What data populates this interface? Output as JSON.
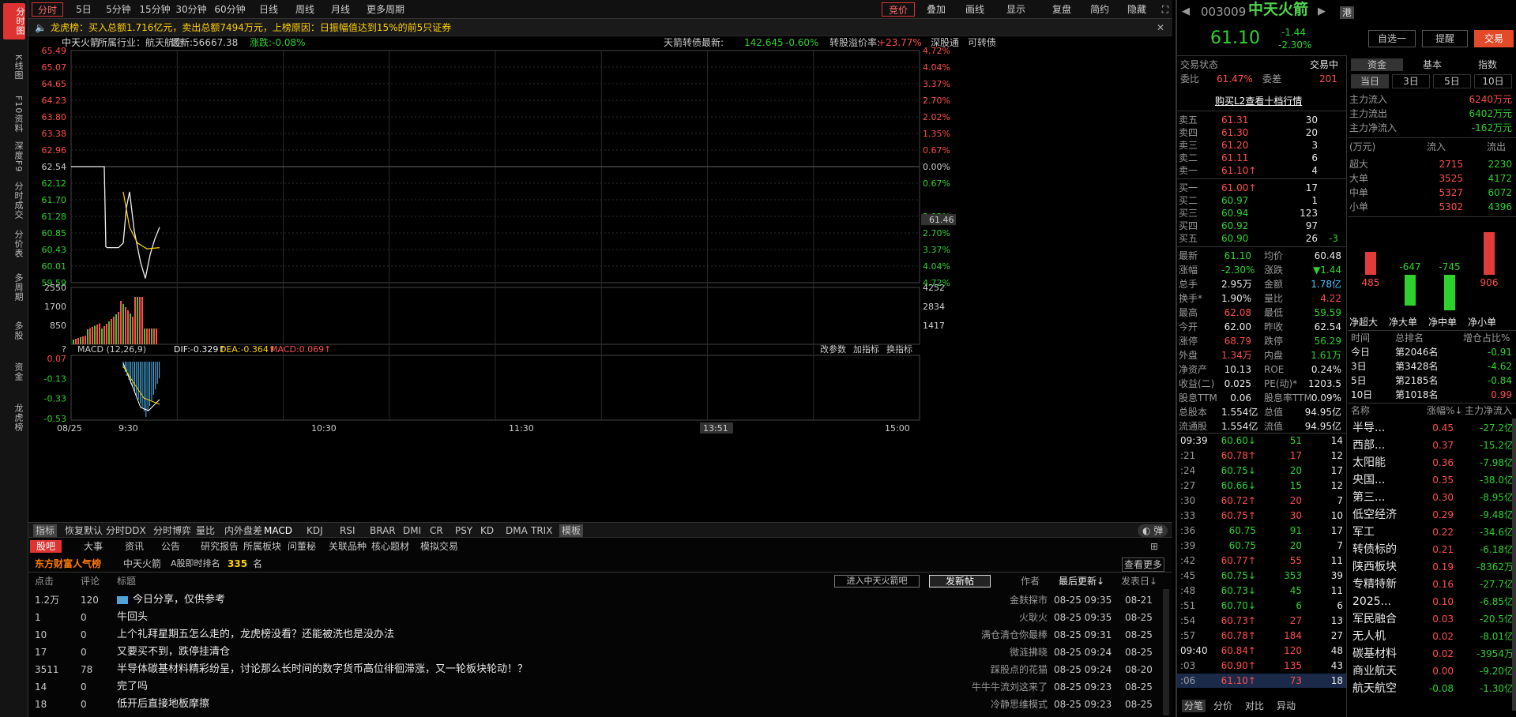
{
  "left_nav": [
    "分时图",
    "K线图",
    "F10资料",
    "深度F9",
    "分时成交",
    "分价表",
    "多周期",
    "多股",
    "资金",
    "龙虎榜"
  ],
  "toolbar": {
    "tabs": [
      "分时",
      "5日",
      "5分钟",
      "15分钟",
      "30分钟",
      "60分钟",
      "日线",
      "周线",
      "月线",
      "更多周期"
    ],
    "right": [
      "竞价",
      "叠加",
      "画线",
      "显示",
      "复盘",
      "简约",
      "隐藏"
    ]
  },
  "notice": "龙虎榜：买入总额1.716亿元，卖出总额7494万元，上榜原因：日振幅值达到15%的前5只证券",
  "chart_header": {
    "name": "中天火箭",
    "industry": "所属行业：航天航空",
    "latest": "最新:56667.38",
    "change": "涨跌:-0.08%",
    "convertible": "天箭转债最新:",
    "cv_price": "142.645",
    "cv_change": "-0.60%",
    "premium_label": "转股溢价率:",
    "premium": "+23.77%",
    "links": [
      "深股通",
      "可转债"
    ]
  },
  "price_axis_left": [
    "65.49",
    "65.07",
    "64.65",
    "64.23",
    "63.80",
    "63.38",
    "62.96",
    "62.54",
    "62.12",
    "61.70",
    "61.28",
    "60.85",
    "60.43",
    "60.01",
    "59.59"
  ],
  "price_axis_right": [
    "4.72%",
    "4.04%",
    "3.37%",
    "2.70%",
    "2.02%",
    "1.35%",
    "0.67%",
    "0.00%",
    "0.67%",
    "2.02%",
    "2.70%",
    "3.37%",
    "4.04%",
    "4.72%"
  ],
  "price_marker": "61.46",
  "vol_axis_left": [
    "2550",
    "1700",
    "850"
  ],
  "vol_axis_right": [
    "4252",
    "2834",
    "1417"
  ],
  "macd": {
    "label": "MACD (12,26,9)",
    "dif": "DIF:-0.329↑",
    "dea": "DEA:-0.364↑",
    "macd": "MACD:0.069↑",
    "axis": [
      "0.07",
      "-0.13",
      "-0.33",
      "-0.53"
    ],
    "buttons": [
      "改参数",
      "加指标",
      "换指标"
    ]
  },
  "time_axis": [
    "08/25",
    "9:30",
    "10:30",
    "11:30",
    "13:51",
    "15:00"
  ],
  "indicator_tabs": [
    "指标",
    "恢复默认",
    "分时DDX",
    "分时博弈",
    "量比",
    "内外盘差",
    "MACD",
    "KDJ",
    "RSI",
    "BRAR",
    "DMI",
    "CR",
    "PSY",
    "KD",
    "DMA",
    "TRIX",
    "模板"
  ],
  "forum": {
    "tabs": [
      "股吧",
      "大事",
      "资讯",
      "公告",
      "研究报告",
      "所属板块",
      "问董秘",
      "关联品种",
      "核心题材",
      "模拟交易"
    ],
    "brand": "东方财富人气榜",
    "stock": "中天火箭",
    "rank_label": "A股即时排名",
    "rank": "335",
    "rank_unit": "名",
    "more": "查看更多",
    "cols": [
      "点击",
      "评论",
      "标题"
    ],
    "enter": "进入中天火箭吧",
    "post": "发新帖",
    "author_col": "作者",
    "latest_col": "最后更新↓",
    "post_col": "发表日↓",
    "rows": [
      {
        "clicks": "1.2万",
        "comments": "120",
        "title": "今日分享，仅供参考",
        "author": "金麸探市",
        "updated": "08-25 09:35",
        "posted": "08-21"
      },
      {
        "clicks": "1",
        "comments": "0",
        "title": "牛回头",
        "author": "火耿火",
        "updated": "08-25 09:35",
        "posted": "08-25"
      },
      {
        "clicks": "10",
        "comments": "0",
        "title": "上个礼拜星期五怎么走的，龙虎榜没看？还能被洗也是没办法",
        "author": "满仓清仓你最棒",
        "updated": "08-25 09:31",
        "posted": "08-25"
      },
      {
        "clicks": "17",
        "comments": "0",
        "title": "又要买不到，跌停挂清仓",
        "author": "微涟拂晓",
        "updated": "08-25 09:24",
        "posted": "08-25"
      },
      {
        "clicks": "3511",
        "comments": "78",
        "title": "半导体碳基材料精彩纷呈，讨论那么长时间的数字货币高位徘徊滞涨，又一轮板块轮动！？",
        "author": "踩股点的花猫",
        "updated": "08-25 09:24",
        "posted": "08-20"
      },
      {
        "clicks": "14",
        "comments": "0",
        "title": "完了吗",
        "author": "牛牛牛流刘这来了",
        "updated": "08-25 09:23",
        "posted": "08-25"
      },
      {
        "clicks": "18",
        "comments": "0",
        "title": "低开后直接地板摩擦",
        "author": "冷静思维模式",
        "updated": "08-25 09:23",
        "posted": "08-25"
      }
    ]
  },
  "quote": {
    "code": "003009",
    "name": "中天火箭",
    "market": "港",
    "price": "61.10",
    "change": "-1.44",
    "pct": "-2.30%",
    "buttons": [
      "自选一",
      "提醒",
      "交易"
    ],
    "status_label": "交易状态",
    "status": "交易中",
    "wb_label": "委比",
    "wb": "61.47%",
    "wc_label": "委差",
    "wc": "201",
    "l2": "购买L2查看十档行情",
    "asks": [
      [
        "卖五",
        "61.31",
        "30"
      ],
      [
        "卖四",
        "61.30",
        "20"
      ],
      [
        "卖三",
        "61.20",
        "3"
      ],
      [
        "卖二",
        "61.11",
        "6"
      ],
      [
        "卖一",
        "61.10↑",
        "4"
      ]
    ],
    "bids": [
      [
        "买一",
        "61.00↑",
        "17"
      ],
      [
        "买二",
        "60.97",
        "1"
      ],
      [
        "买三",
        "60.94",
        "123"
      ],
      [
        "买四",
        "60.92",
        "97"
      ],
      [
        "买五",
        "60.90",
        "26"
      ]
    ],
    "bid5_delta": "-3",
    "stats": [
      [
        "最新",
        "61.10",
        "均价",
        "60.48"
      ],
      [
        "涨幅",
        "-2.30%",
        "涨跌",
        "▼1.44"
      ],
      [
        "总手",
        "2.95万",
        "金额",
        "1.78亿"
      ],
      [
        "换手*",
        "1.90%",
        "量比",
        "4.22"
      ],
      [
        "最高",
        "62.08",
        "最低",
        "59.59"
      ],
      [
        "今开",
        "62.00",
        "昨收",
        "62.54"
      ],
      [
        "涨停",
        "68.79",
        "跌停",
        "56.29"
      ],
      [
        "外盘",
        "1.34万",
        "内盘",
        "1.61万"
      ],
      [
        "净资产",
        "10.13",
        "ROE",
        "0.24%"
      ],
      [
        "收益(二)",
        "0.025",
        "PE(动)*",
        "1203.5"
      ],
      [
        "股息TTM",
        "0.06",
        "股息率TTM",
        "0.09%"
      ],
      [
        "总股本",
        "1.554亿",
        "总值",
        "94.95亿"
      ],
      [
        "流通股",
        "1.554亿",
        "流值",
        "94.95亿"
      ]
    ]
  },
  "ticks": [
    [
      "09:39",
      "60.60↓",
      "51",
      "14"
    ],
    [
      ":21",
      "60.78↑",
      "17",
      "12"
    ],
    [
      ":24",
      "60.75↓",
      "20",
      "17"
    ],
    [
      ":27",
      "60.66↓",
      "15",
      "12"
    ],
    [
      ":30",
      "60.72↑",
      "20",
      "7"
    ],
    [
      ":33",
      "60.75↑",
      "30",
      "10"
    ],
    [
      ":36",
      "60.75",
      "91",
      "17"
    ],
    [
      ":39",
      "60.75",
      "20",
      "7"
    ],
    [
      ":42",
      "60.77↑",
      "55",
      "11"
    ],
    [
      ":45",
      "60.75↓",
      "353",
      "39"
    ],
    [
      ":48",
      "60.73↓",
      "45",
      "11"
    ],
    [
      ":51",
      "60.70↓",
      "6",
      "6"
    ],
    [
      ":54",
      "60.73↑",
      "27",
      "13"
    ],
    [
      ":57",
      "60.78↑",
      "184",
      "27"
    ],
    [
      "09:40",
      "60.84↑",
      "120",
      "48"
    ],
    [
      ":03",
      "60.90↑",
      "135",
      "43"
    ],
    [
      ":06",
      "61.10↑",
      "73",
      "18"
    ]
  ],
  "tick_tabs": [
    "分笔",
    "分价",
    "对比",
    "异动"
  ],
  "fund": {
    "tabs": [
      "资金",
      "基本",
      "指数"
    ],
    "subtabs": [
      "当日",
      "3日",
      "5日",
      "10日"
    ],
    "main": [
      [
        "主力流入",
        "6240万元"
      ],
      [
        "主力流出",
        "6402万元"
      ],
      [
        "主力净流入",
        "-162万元"
      ]
    ],
    "unit": "(万元)",
    "in": "流入",
    "out": "流出",
    "orders": [
      [
        "超大",
        "2715",
        "2230"
      ],
      [
        "大单",
        "3525",
        "4172"
      ],
      [
        "中单",
        "5327",
        "6072"
      ],
      [
        "小单",
        "5302",
        "4396"
      ]
    ],
    "bars": {
      "labels": [
        "净超大",
        "净大单",
        "净中单",
        "净小单"
      ],
      "values": [
        485,
        -647,
        -745,
        906
      ],
      "display": [
        "485",
        "-647",
        "-745",
        "906"
      ]
    },
    "rank_cols": [
      "时间",
      "总排名",
      "增仓占比%"
    ],
    "ranks": [
      [
        "今日",
        "第2046名",
        "-0.91"
      ],
      [
        "3日",
        "第3428名",
        "-4.62"
      ],
      [
        "5日",
        "第2185名",
        "-0.84"
      ],
      [
        "10日",
        "第1018名",
        "0.99"
      ]
    ],
    "sector_cols": [
      "名称",
      "涨幅%↓",
      "主力净流入"
    ],
    "sectors": [
      [
        "半导...",
        "0.45",
        "-27.2亿"
      ],
      [
        "西部...",
        "0.37",
        "-15.2亿"
      ],
      [
        "太阳能",
        "0.36",
        "-7.98亿"
      ],
      [
        "央国...",
        "0.35",
        "-38.0亿"
      ],
      [
        "第三...",
        "0.30",
        "-8.95亿"
      ],
      [
        "低空经济",
        "0.29",
        "-9.48亿"
      ],
      [
        "军工",
        "0.22",
        "-34.6亿"
      ],
      [
        "转债标的",
        "0.21",
        "-6.18亿"
      ],
      [
        "陕西板块",
        "0.19",
        "-8362万"
      ],
      [
        "专精特新",
        "0.16",
        "-27.7亿"
      ],
      [
        "2025...",
        "0.10",
        "-6.85亿"
      ],
      [
        "军民融合",
        "0.03",
        "-20.5亿"
      ],
      [
        "无人机",
        "0.02",
        "-8.01亿"
      ],
      [
        "碳基材料",
        "0.02",
        "-3954万"
      ],
      [
        "商业航天",
        "0.00",
        "-9.20亿"
      ],
      [
        "航天航空",
        "-0.08",
        "-1.30亿"
      ]
    ]
  }
}
